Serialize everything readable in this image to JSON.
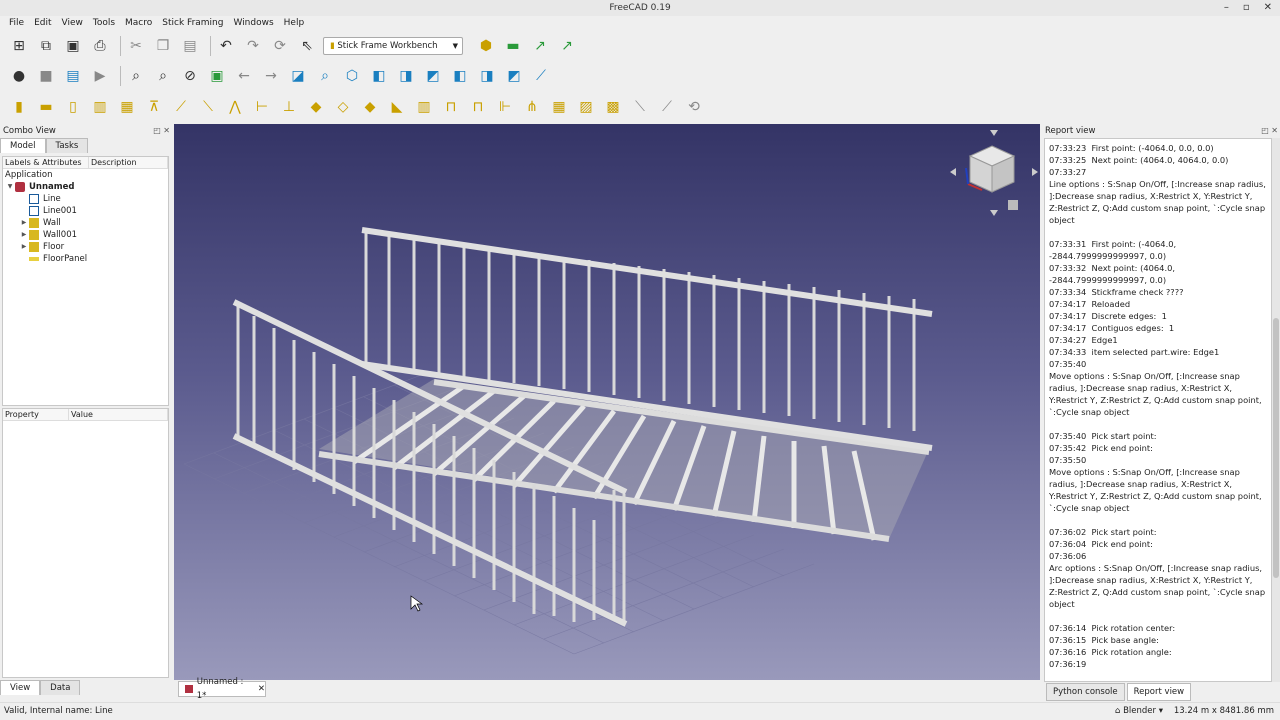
{
  "window": {
    "title": "FreeCAD 0.19"
  },
  "menu": [
    "File",
    "Edit",
    "View",
    "Tools",
    "Macro",
    "Stick Framing",
    "Windows",
    "Help"
  ],
  "toolbar": {
    "workbench": "Stick Frame Workbench"
  },
  "combo_view": {
    "title": "Combo View",
    "tabs": [
      "Model",
      "Tasks"
    ],
    "tree_headers": [
      "Labels & Attributes",
      "Description"
    ],
    "tree_root": "Application",
    "document": "Unnamed",
    "items": [
      "Line",
      "Line001",
      "Wall",
      "Wall001",
      "Floor",
      "FloorPanel"
    ],
    "property_headers": [
      "Property",
      "Value"
    ],
    "bottom_tabs": [
      "View",
      "Data"
    ]
  },
  "document_tab": "Unnamed : 1*",
  "report_view": {
    "title": "Report view",
    "lines": [
      "07:33:23  First point: (-4064.0, 0.0, 0.0)",
      "07:33:25  Next point: (4064.0, 4064.0, 0.0)",
      "07:33:27",
      "Line options : S:Snap On/Off, [:Increase snap radius, ]:Decrease snap radius, X:Restrict X, Y:Restrict Y, Z:Restrict Z, Q:Add custom snap point, `:Cycle snap object",
      "",
      "07:33:31  First point: (-4064.0, -2844.7999999999997, 0.0)",
      "07:33:32  Next point: (4064.0, -2844.7999999999997, 0.0)",
      "07:33:34  Stickframe check ????",
      "07:34:17  Reloaded",
      "07:34:17  Discrete edges:  1",
      "07:34:17  Contiguos edges:  1",
      "07:34:27  Edge1",
      "07:34:33  item selected part.wire: Edge1",
      "07:35:40",
      "Move options : S:Snap On/Off, [:Increase snap radius, ]:Decrease snap radius, X:Restrict X, Y:Restrict Y, Z:Restrict Z, Q:Add custom snap point, `:Cycle snap object",
      "",
      "07:35:40  Pick start point:",
      "07:35:42  Pick end point:",
      "07:35:50",
      "Move options : S:Snap On/Off, [:Increase snap radius, ]:Decrease snap radius, X:Restrict X, Y:Restrict Y, Z:Restrict Z, Q:Add custom snap point, `:Cycle snap object",
      "",
      "07:36:02  Pick start point:",
      "07:36:04  Pick end point:",
      "07:36:06",
      "Arc options : S:Snap On/Off, [:Increase snap radius, ]:Decrease snap radius, X:Restrict X, Y:Restrict Y, Z:Restrict Z, Q:Add custom snap point, `:Cycle snap object",
      "",
      "07:36:14  Pick rotation center:",
      "07:36:15  Pick base angle:",
      "07:36:16  Pick rotation angle:",
      "07:36:19"
    ],
    "tabs": [
      "Python console",
      "Report view"
    ]
  },
  "status": {
    "message": "Valid, Internal name: Line",
    "nav_style": "Blender",
    "dimensions": "13.24 m x 8481.86 mm"
  }
}
